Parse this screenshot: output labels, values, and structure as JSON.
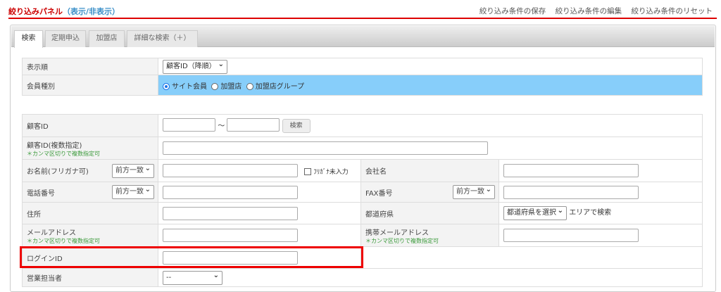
{
  "header": {
    "title": "絞り込みパネル",
    "toggle": "（表示/非表示）",
    "links": [
      "絞り込み条件の保存",
      "絞り込み条件の編集",
      "絞り込み条件のリセット"
    ]
  },
  "tabs": [
    "検索",
    "定期申込",
    "加盟店",
    "詳細な検索（＋）"
  ],
  "sort": {
    "label": "表示順",
    "value": "顧客ID（降順）"
  },
  "member_type": {
    "label": "会員種別",
    "options": [
      "サイト会員",
      "加盟店",
      "加盟店グループ"
    ],
    "selected": "サイト会員",
    "bg": "#87cefa"
  },
  "fields": {
    "customer_id": {
      "label": "顧客ID",
      "sep": "～",
      "button": "検索"
    },
    "customer_ids": {
      "label": "顧客ID(複数指定)",
      "note": "＊カンマ区切りで複数指定可"
    },
    "name": {
      "label": "お名前(フリガナ可)",
      "match": "前方一致",
      "checkbox": "ﾌﾘｶﾞﾅ未入力"
    },
    "company": {
      "label": "会社名"
    },
    "phone": {
      "label": "電話番号",
      "match": "前方一致"
    },
    "fax": {
      "label": "FAX番号",
      "match": "前方一致"
    },
    "address": {
      "label": "住所"
    },
    "prefecture": {
      "label": "都道府県",
      "select": "都道府県を選択",
      "area": "エリアで検索"
    },
    "email": {
      "label": "メールアドレス",
      "note": "＊カンマ区切りで複数指定可"
    },
    "mobile_email": {
      "label": "携帯メールアドレス",
      "note": "＊カンマ区切りで複数指定可"
    },
    "login_id": {
      "label": "ログインID"
    },
    "sales": {
      "label": "営業担当者",
      "select": "--"
    }
  }
}
